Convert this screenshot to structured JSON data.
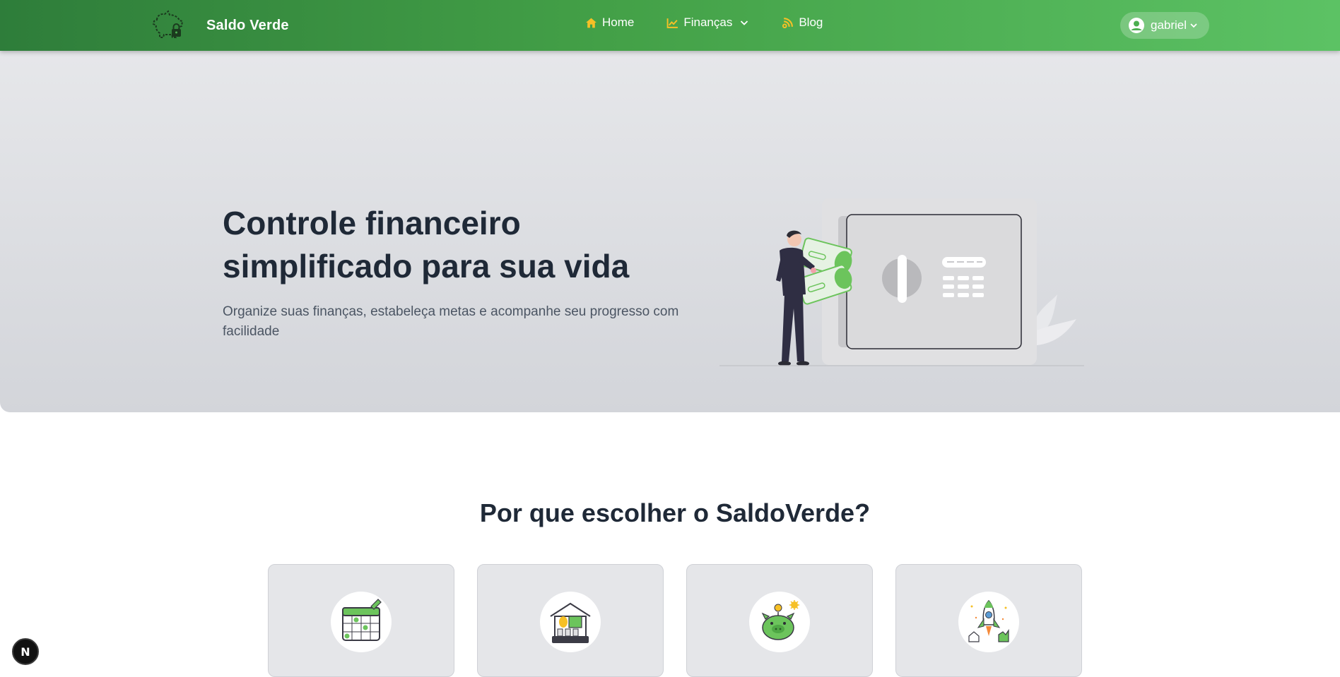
{
  "navbar": {
    "brand_name": "Saldo Verde",
    "links": [
      {
        "label": "Home",
        "icon": "home-icon"
      },
      {
        "label": "Finanças",
        "icon": "chart-line-icon"
      },
      {
        "label": "Blog",
        "icon": "blog-icon"
      }
    ],
    "user": {
      "name": "gabriel",
      "icon": "user-circle-icon"
    }
  },
  "hero": {
    "title_line1": "Controle financeiro",
    "title_line2": "simplificado para sua vida",
    "subtitle": "Organize suas finanças, estabeleça metas e acompanhe seu progresso com facilidade"
  },
  "features": {
    "title": "Por que escolher o SaldoVerde?",
    "cards": [
      {
        "icon": "calendar-icon"
      },
      {
        "icon": "house-savings-icon"
      },
      {
        "icon": "piggy-bank-icon"
      },
      {
        "icon": "rocket-icon"
      }
    ]
  },
  "dev_badge": {
    "label": "N"
  },
  "colors": {
    "nav_start": "#2e7d3a",
    "nav_end": "#5cc264",
    "accent_yellow": "#f6c026",
    "text_dark": "#1f2937",
    "text_muted": "#4b5563",
    "illustration_green": "#6cc45c"
  }
}
